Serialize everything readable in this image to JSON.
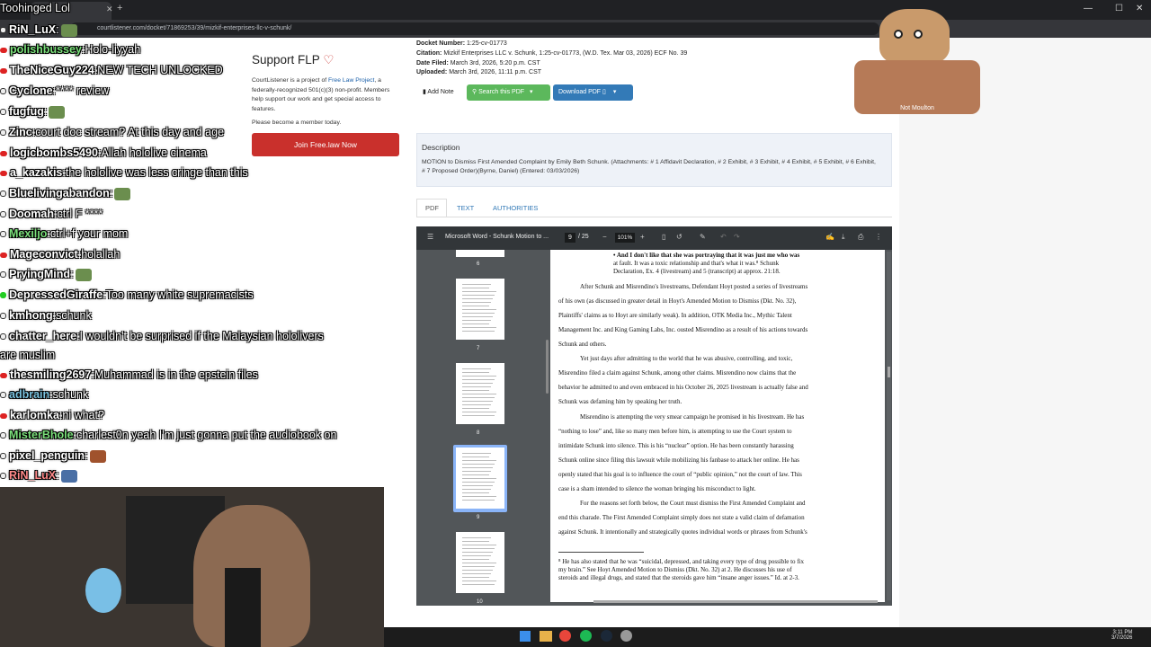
{
  "browser": {
    "tab_title": "Toohinged Lol",
    "url": "courtlistener.com/docket/71869253/39/mizkif-enterprises-llc-v-schunk/"
  },
  "chat": {
    "messages": [
      {
        "user": "RiN_LuX",
        "text": "",
        "color": "#ffffff",
        "badge": "b"
      },
      {
        "user": "polishbussey",
        "text": "Holo-liyyah",
        "color": "#7be07b",
        "badge": "r"
      },
      {
        "user": "TheNiceGuy224",
        "text": "NEW TECH UNLOCKED",
        "color": "#ffffff",
        "badge": "r"
      },
      {
        "user": "Cyclone",
        "text": "**** review",
        "color": "#ffffff",
        "badge": "b"
      },
      {
        "user": "fugfug",
        "text": "",
        "color": "#ffffff",
        "badge": "b"
      },
      {
        "user": "Zinc",
        "text": "court doc stream? At this day and age",
        "color": "#ffffff",
        "badge": "b"
      },
      {
        "user": "logicbombs5490",
        "text": "Allah hololive cinema",
        "color": "#ffffff",
        "badge": "r"
      },
      {
        "user": "a_kazakis",
        "text": "the hololive was less cringe than this",
        "color": "#ffffff",
        "badge": "r"
      },
      {
        "user": "Bluelivingabandon",
        "text": "",
        "color": "#ffffff",
        "badge": "b"
      },
      {
        "user": "Doomah",
        "text": "ctrl F ****",
        "color": "#ffffff",
        "badge": "b"
      },
      {
        "user": "Mexiljo",
        "text": "ctrl+f your mom",
        "color": "#7be07b",
        "badge": "b"
      },
      {
        "user": "Mageconvict",
        "text": "holallah",
        "color": "#ffffff",
        "badge": "r"
      },
      {
        "user": "PryingMind",
        "text": "",
        "color": "#ffffff",
        "badge": "b"
      },
      {
        "user": "DepressedGiraffe",
        "text": "Too many white supremacists",
        "color": "#ffffff",
        "badge": "g"
      },
      {
        "user": "kmhong",
        "text": "schunk",
        "color": "#ffffff",
        "badge": "b"
      },
      {
        "user": "chatter_here",
        "text": "I wouldn't be surprised if the Malaysian hololivers",
        "color": "#ffffff",
        "badge": "b"
      },
      {
        "user": "",
        "text": "are muslim",
        "color": "#ffffff",
        "badge": ""
      },
      {
        "user": "thesmiling2697",
        "text": "Muhammad is in the epstein files",
        "color": "#ffffff",
        "badge": "r"
      },
      {
        "user": "adbrain",
        "text": "schunk",
        "color": "#7bc3e0",
        "badge": "b"
      },
      {
        "user": "karlomka",
        "text": "ni what?",
        "color": "#ffffff",
        "badge": "r"
      },
      {
        "user": "MisterBhole",
        "text": "charlest0n yeah I'm just gonna put the audiobook on",
        "color": "#7be07b",
        "badge": "b"
      },
      {
        "user": "pixel_penguin",
        "text": "",
        "color": "#ffffff",
        "badge": "b"
      },
      {
        "user": "RiN_LuX",
        "text": "",
        "color": "#ff8a8a",
        "badge": "b"
      }
    ]
  },
  "support": {
    "title": "Support FLP",
    "text_pre": "CourtListener is a project of ",
    "link": "Free Law Project",
    "text_post": ", a federally-recognized 501(c)(3) non-profit. Members help support our work and get special access to features.",
    "member": "Please become a member today.",
    "join": "Join Free.law Now"
  },
  "docket": {
    "number_label": "Docket Number:",
    "number": "1:25-cv-01773",
    "citation_label": "Citation:",
    "citation": "Mizkif Enterprises LLC v. Schunk, 1:25-cv-01773, (W.D. Tex. Mar 03, 2026) ECF No. 39",
    "filed_label": "Date Filed:",
    "filed": "March 3rd, 2026, 5:20 p.m. CST",
    "uploaded_label": "Uploaded:",
    "uploaded": "March 3rd, 2026, 11:11 p.m. CST"
  },
  "actions": {
    "add_note": "Add Note",
    "search_pdf": "Search this PDF",
    "download_pdf": "Download PDF"
  },
  "description": {
    "title": "Description",
    "text": "MOTION to Dismiss First Amended Complaint by Emily Beth Schunk. (Attachments: # 1 Affidavit Declaration, # 2 Exhibit, # 3 Exhibit, # 4 Exhibit, # 5 Exhibit, # 6 Exhibit, # 7 Proposed Order)(Byrne, Daniel) (Entered: 03/03/2026)"
  },
  "tabs": [
    "PDF",
    "TEXT",
    "AUTHORITIES"
  ],
  "pdf": {
    "title": "Microsoft Word - Schunk Motion to ...",
    "page": "9",
    "total": "/ 25",
    "zoom": "101%",
    "thumb_numbers": [
      "6",
      "7",
      "8",
      "9",
      "10"
    ],
    "lines": [
      "•   And I don't like that she was portraying that it was just me who was",
      "     at fault.  It was a toxic relationship and that's what it was.⁸   Schunk",
      "     Declaration, Ex. 4 (livestream) and 5 (transcript) at approx. 21:18.",
      "After Schunk and Misrendino's livestreams, Defendant Hoyt posted a series of livestreams",
      "of his own (as discussed in greater detail in Hoyt's Amended Motion to Dismiss (Dkt. No. 32),",
      "Plaintiffs' claims as to Hoyt are similarly weak).  In addition, OTK Media Inc., Mythic Talent",
      "Management Inc. and King Gaming Labs, Inc. ousted Misrendino as a result of his actions towards",
      "Schunk and others.",
      "Yet just days after admitting to the world that he was abusive, controlling, and toxic,",
      "Misrendino filed a claim against Schunk, among other claims.  Misrendino now claims that the",
      "behavior he admitted to and even embraced in his October 26, 2025 livestream is actually false and",
      "Schunk was defaming him by speaking her truth.",
      "Misrendino is attempting the very smear campaign he promised in his livestream.  He has",
      "“nothing to lose” and, like so many men before him, is attempting to use the Court system to",
      "intimidate Schunk into silence.  This is his “nuclear” option.   He has been constantly harassing",
      "Schunk online since filing this lawsuit while mobilizing his fanbase to attack her online.  He has",
      "openly stated that his goal is to influence the court of “public opinion,” not the court of law.  This",
      "case is a sham intended to silence the woman bringing his misconduct to light.",
      "For the reasons set forth below, the Court must dismiss the First Amended Complaint and",
      "end this charade.  The First Amended Complaint simply does not state a valid claim of defamation",
      "against Schunk.  It intentionally and strategically quotes individual words or phrases from Schunk's",
      "⁸ He has also stated that he was “suicidal, depressed, and taking every type of drug possible to fix",
      "my brain.”  See Hoyt Amended Motion to Dismiss (Dkt. No. 32) at 2.  He discusses his use of",
      "steroids and illegal drugs, and stated that the steroids gave him “insane anger issues.”  Id. at 2-3."
    ]
  },
  "overlay": {
    "avatar_text": "Not Moulton"
  },
  "clock": {
    "time": "3:11 PM",
    "date": "3/7/2026"
  }
}
